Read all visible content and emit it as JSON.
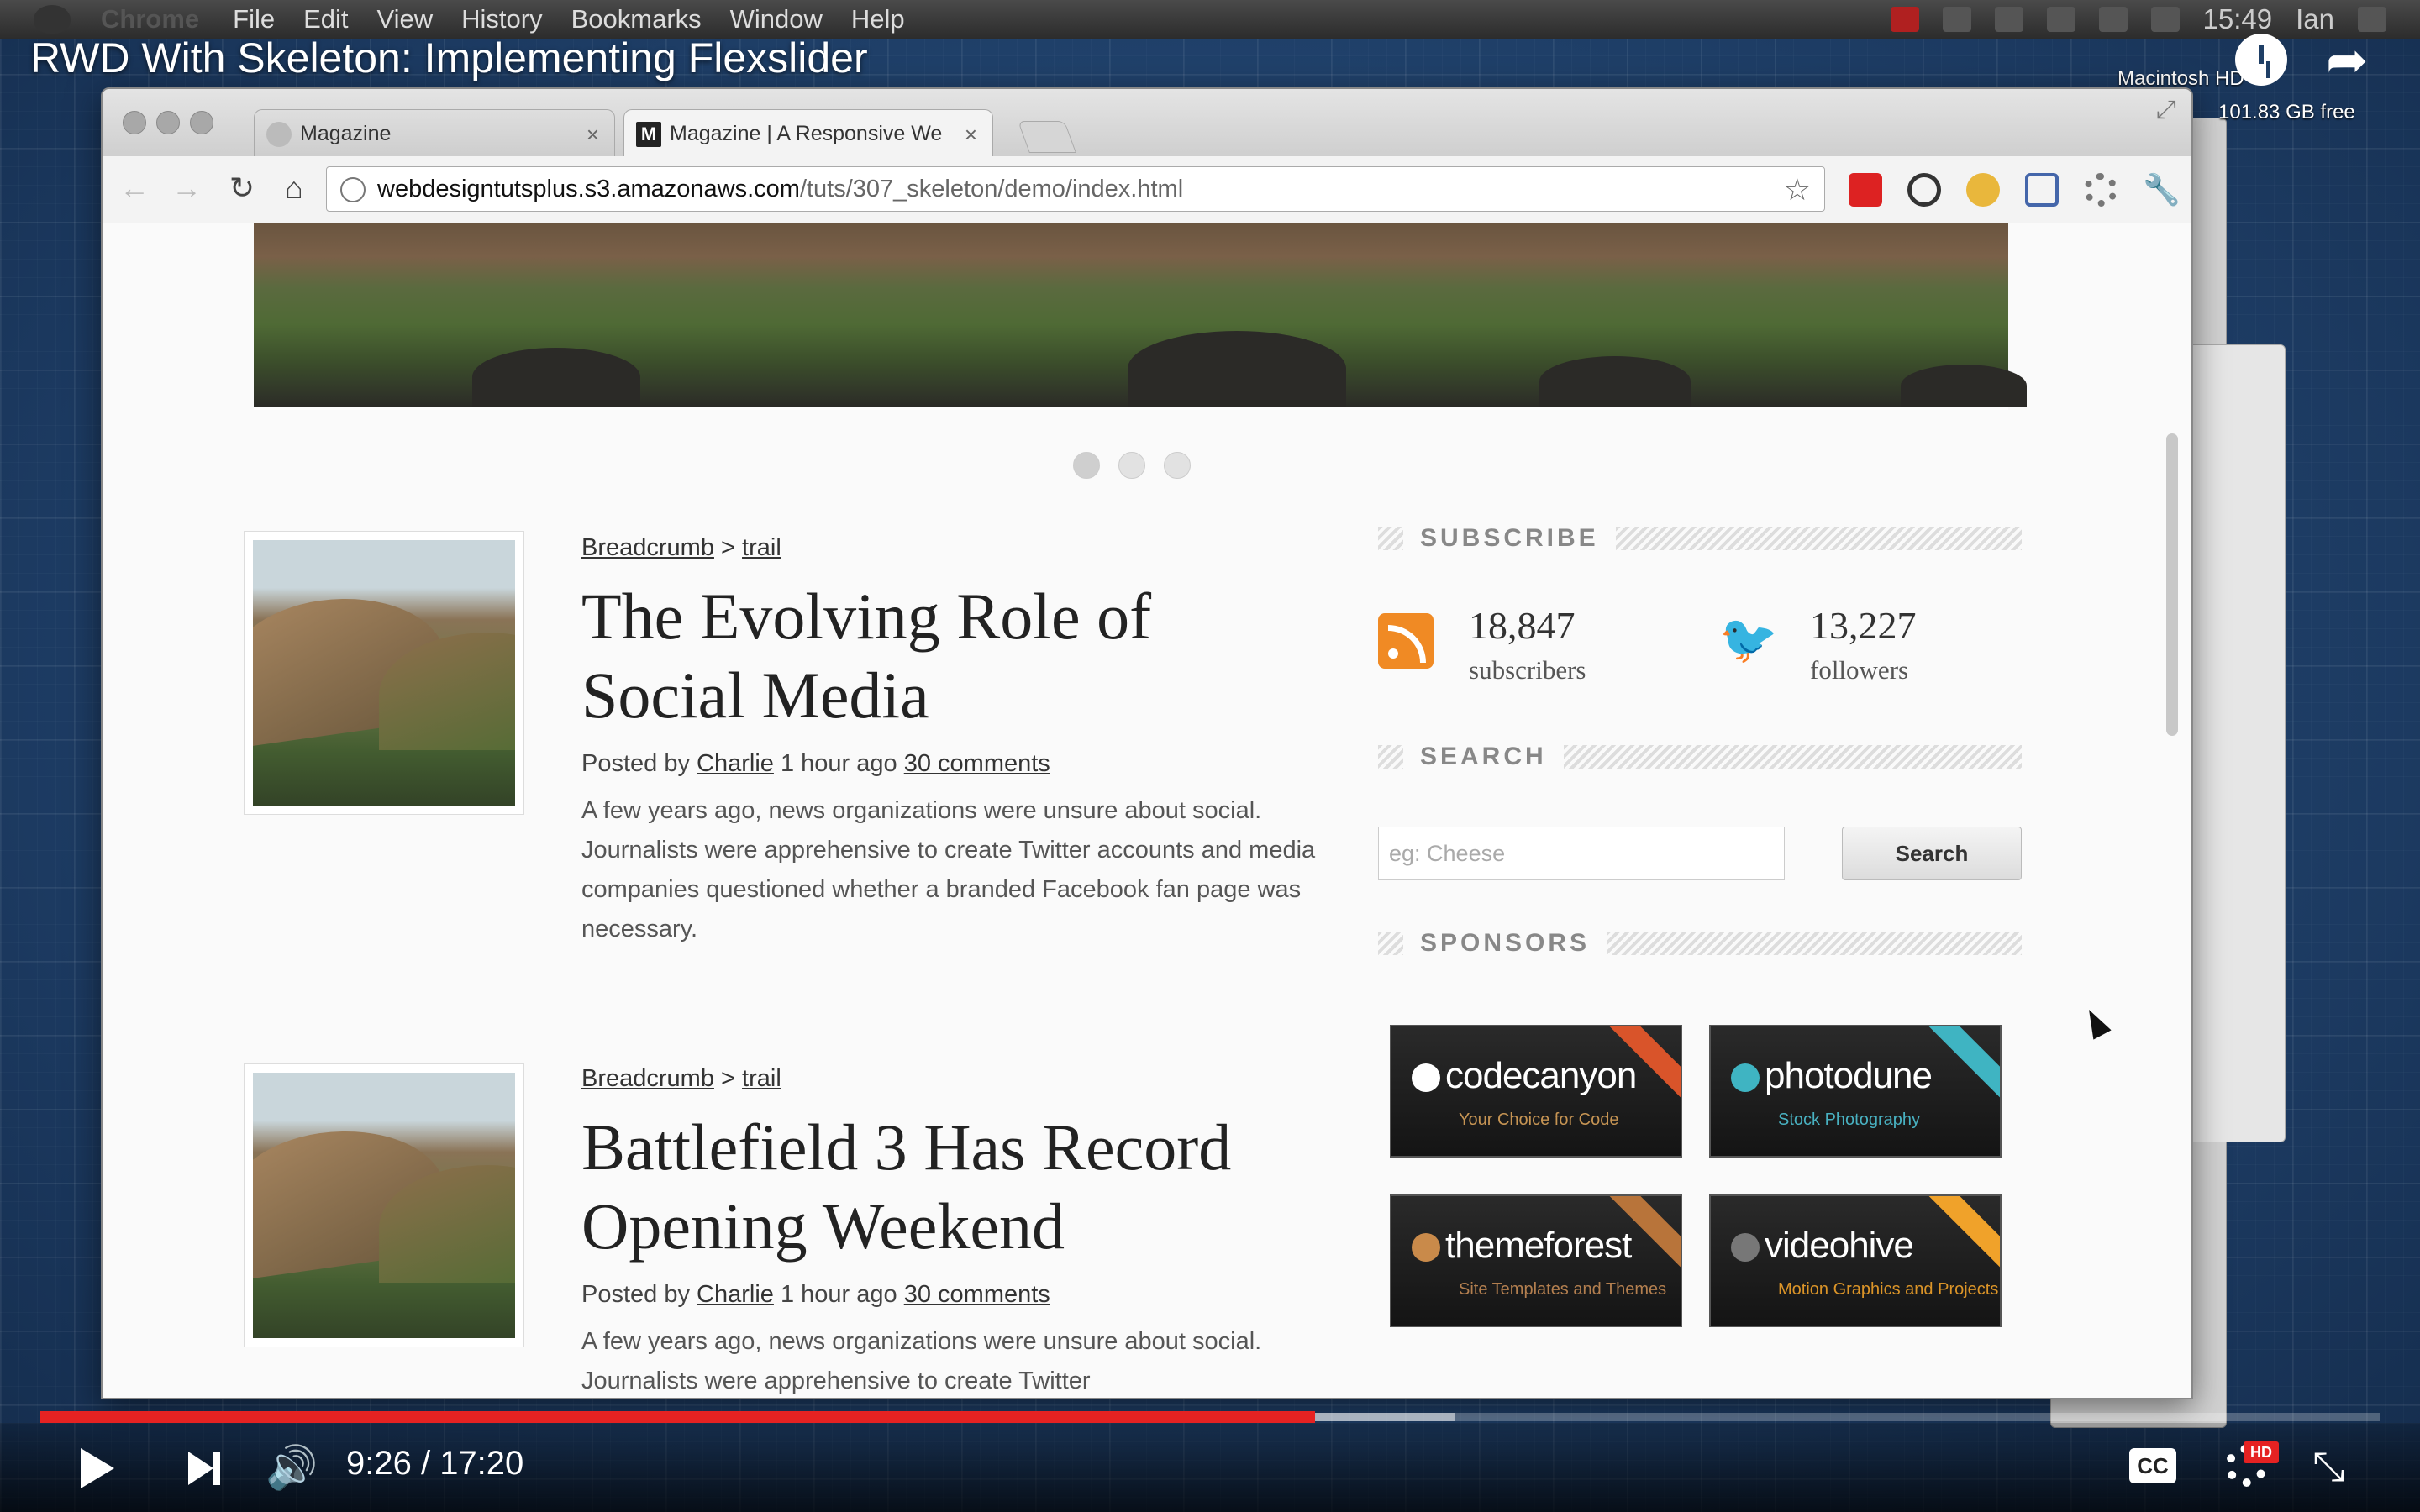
{
  "menubar": {
    "app": "Chrome",
    "items": [
      "File",
      "Edit",
      "View",
      "History",
      "Bookmarks",
      "Window",
      "Help"
    ],
    "clock": "15:49",
    "user": "Ian"
  },
  "video": {
    "title": "RWD With Skeleton: Implementing Flexslider",
    "time": "9:26 / 17:20",
    "progress": 0.545,
    "buffered": 0.605,
    "cc_label": "CC",
    "hd_label": "HD"
  },
  "desktop": {
    "disk_name": "Macintosh HD",
    "disk_free": "101.83 GB free"
  },
  "browser": {
    "tabs": [
      {
        "label": "Magazine"
      },
      {
        "label": "Magazine | A Responsive We"
      }
    ],
    "url_host": "webdesigntutsplus.s3.amazonaws.com",
    "url_path": "/tuts/307_skeleton/demo/index.html"
  },
  "page": {
    "posts": [
      {
        "crumb_a": "Breadcrumb",
        "crumb_sep": ">",
        "crumb_b": "trail",
        "title": "The Evolving Role of Social Media",
        "posted_by": "Posted by",
        "author": "Charlie",
        "time": "1 hour ago",
        "comments": "30 comments",
        "excerpt": "A few years ago, news organizations were unsure about social. Journalists were apprehensive to create Twitter accounts and media companies questioned whether a branded Facebook fan page was necessary."
      },
      {
        "crumb_a": "Breadcrumb",
        "crumb_sep": ">",
        "crumb_b": "trail",
        "title": "Battlefield 3 Has Record Opening Weekend",
        "posted_by": "Posted by",
        "author": "Charlie",
        "time": "1 hour ago",
        "comments": "30 comments",
        "excerpt": "A few years ago, news organizations were unsure about social. Journalists were apprehensive to create Twitter"
      }
    ],
    "sidebar": {
      "subscribe_heading": "SUBSCRIBE",
      "subscribers_count": "18,847",
      "subscribers_label": "subscribers",
      "followers_count": "13,227",
      "followers_label": "followers",
      "search_heading": "SEARCH",
      "search_placeholder": "eg: Cheese",
      "search_button": "Search",
      "sponsors_heading": "SPONSORS",
      "sponsors": [
        {
          "name": "codecanyon",
          "tagline": "Your Choice for Code",
          "accent": "#d9542a"
        },
        {
          "name": "photodune",
          "tagline": "Stock Photography",
          "accent": "#3fb4c2"
        },
        {
          "name": "themeforest",
          "tagline": "Site Templates and Themes",
          "accent": "#b8743a"
        },
        {
          "name": "videohive",
          "tagline": "Motion Graphics and Projects",
          "accent": "#f0a22a"
        }
      ]
    }
  }
}
